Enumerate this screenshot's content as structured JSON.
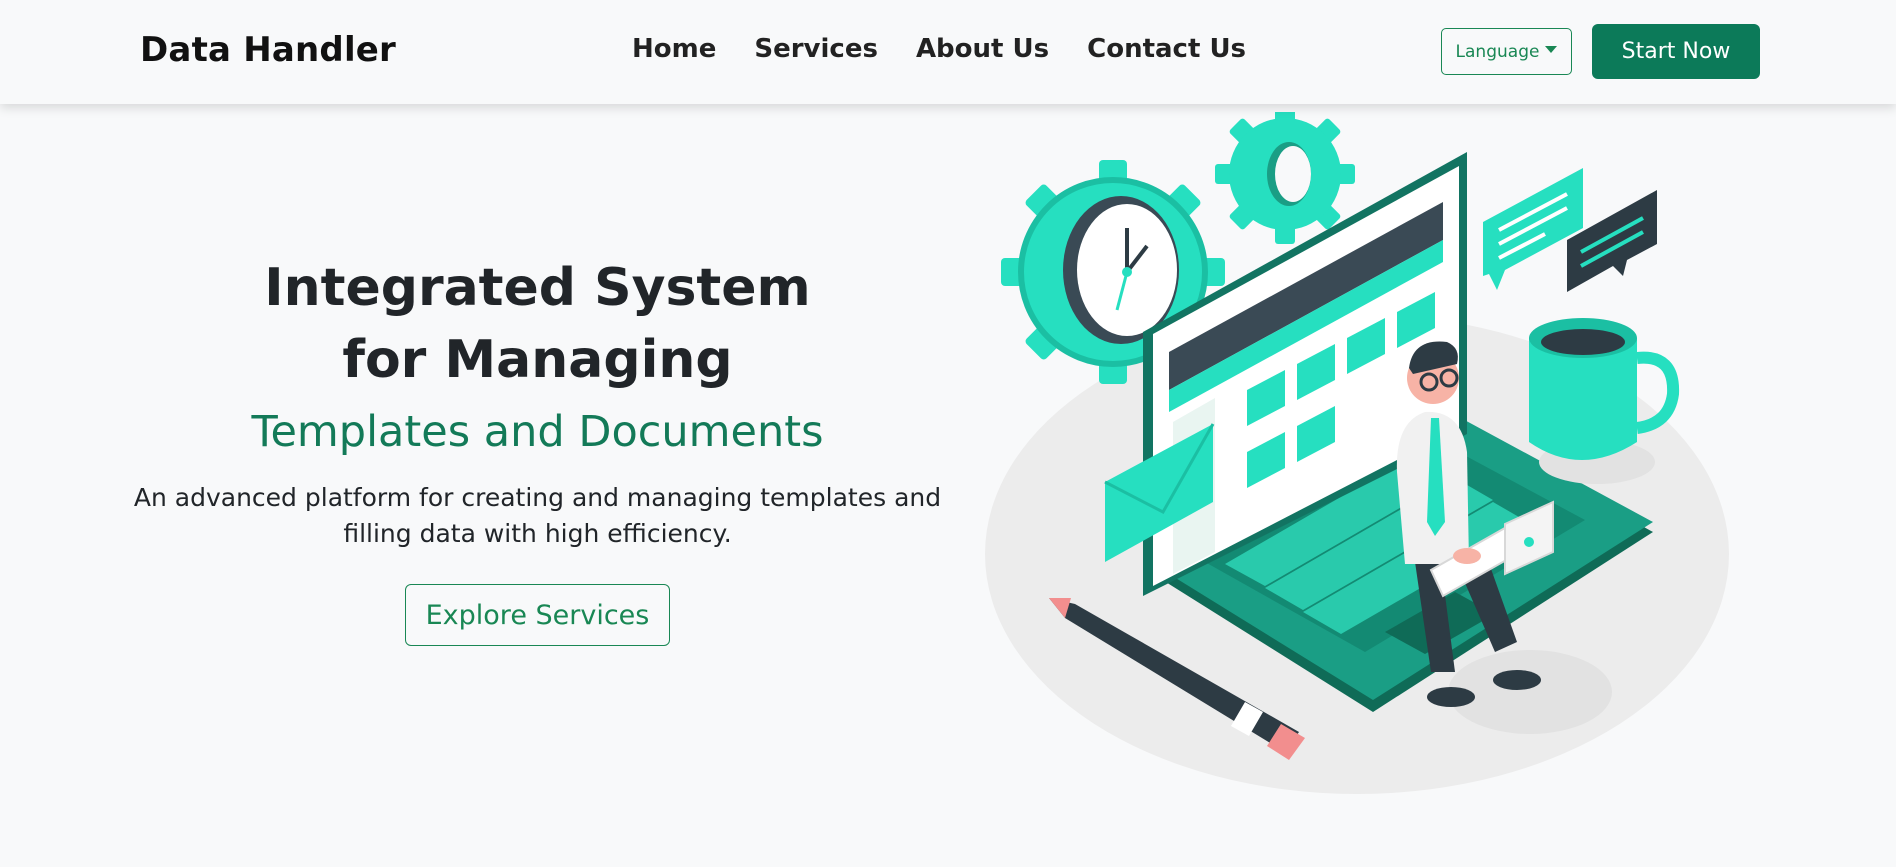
{
  "navbar": {
    "brand": "Data Handler",
    "links": [
      "Home",
      "Services",
      "About Us",
      "Contact Us"
    ],
    "language_label": "Language",
    "start_label": "Start Now"
  },
  "hero": {
    "title": "Integrated System for Managing",
    "subtitle": "Templates and Documents",
    "description": "An advanced platform for creating and managing templates and filling data with high efficiency.",
    "cta_label": "Explore Services"
  },
  "colors": {
    "accent": "#198754",
    "accent_dark": "#0c7a59",
    "illustration_teal": "#26dfc0",
    "background": "#f8f9fa"
  },
  "illustration": {
    "icon": "person-with-laptop-illustration"
  }
}
